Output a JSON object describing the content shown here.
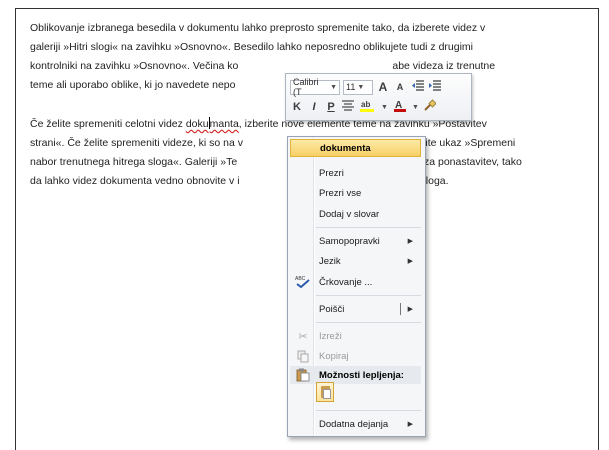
{
  "document": {
    "para1": "Oblikovanje izbranega besedila v dokumentu lahko preprosto spremenite tako, da izberete videz v galeriji »Hitri slogi« na zavihku »Osnovno«. Besedilo lahko neposredno oblikujete tudi z drugimi kontrolniki na zavihku »Osnovno«. Večina kontrolnikov",
    "para1_hidden_tail": " ponuja izbiro med uporabo videza iz trenutne teme ali uporabo oblike, ki jo navedete neposredno.",
    "para1_line_a": "Oblikovanje izbranega besedila v dokumentu lahko preprosto spremenite tako, da izberete videz v",
    "para1_line_b1": "galeriji »Hitri slogi« na zavihku »Osnovno«. Besedilo lahko neposredno oblikujete tudi z drugimi",
    "para1_line_c1": "kontrolniki na zavihku »Osnovno«. Večina ko",
    "para1_line_c2": "abe videza iz trenutne",
    "para1_line_d1": "teme ali uporabo oblike, ki jo navedete nepo",
    "para2_line_a1": "Če želite spremeniti celotni videz ",
    "para2_word_a": "doku",
    "para2_word_b": "manta",
    "para2_line_a2": ", izberite nove elemente teme na zavihku »Postavitev",
    "para2_line_b1": "strani«. Če želite spremeniti videze, ki so na v",
    "para2_line_b2": "«, uporabite ukaz »Spremeni",
    "para2_line_c1": "nabor trenutnega hitrega sloga«. Galeriji »Te",
    "para2_line_c2": "ujeta ukaz za ponastavitev, tako",
    "para2_line_d1": "da lahko videz dokumenta vedno obnovite v i",
    "para2_line_d2": "nutna predloga."
  },
  "minitoolbar": {
    "font": "Calibri (T",
    "size": "11",
    "grow": "A",
    "shrink": "A",
    "bold": "K",
    "italic": "I",
    "underline": "P"
  },
  "context_menu": {
    "suggestion": "dokumenta",
    "items": [
      {
        "label": "Prezri"
      },
      {
        "label": "Prezri vse"
      },
      {
        "label": "Dodaj v slovar"
      },
      {
        "label": "Samopopravki"
      },
      {
        "label": "Jezik"
      },
      {
        "label": "Črkovanje ..."
      },
      {
        "label": "Poišči"
      },
      {
        "label": "Izreži"
      },
      {
        "label": "Kopiraj"
      },
      {
        "label": "Možnosti lepljenja:"
      },
      {
        "label": "Dodatna dejanja"
      }
    ]
  },
  "colors": {
    "highlight": "#ffff00",
    "font_color": "#c00000",
    "selection": "#f8d064"
  }
}
